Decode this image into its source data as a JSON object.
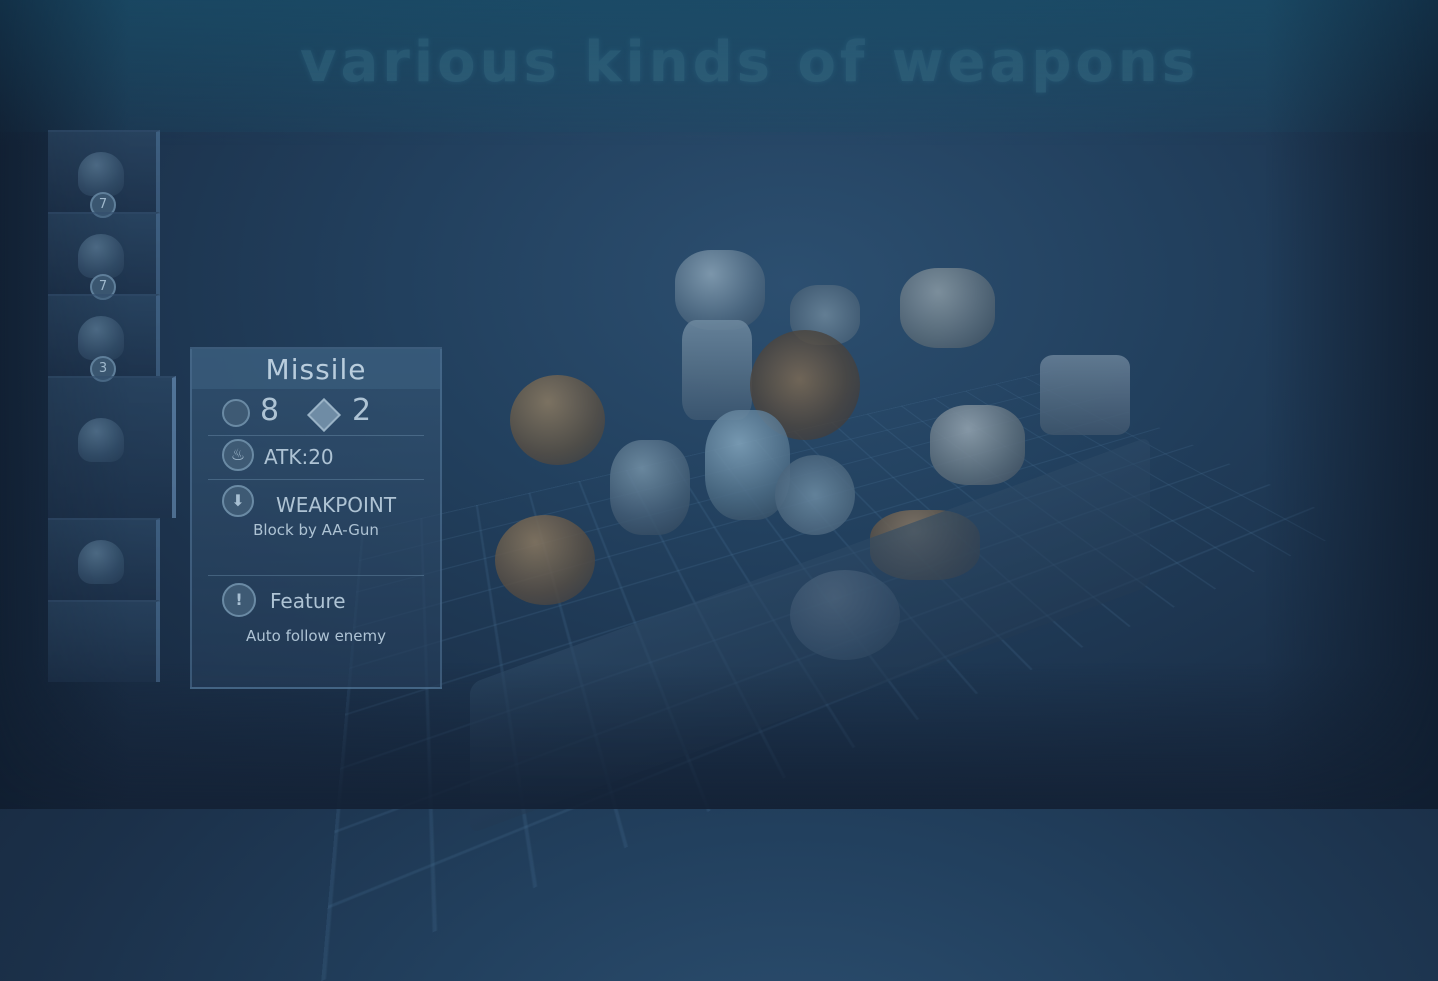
{
  "banner": {
    "title": "various kinds of weapons"
  },
  "inventory": {
    "slots": [
      {
        "count": "7"
      },
      {
        "count": "7"
      },
      {
        "count": "3"
      }
    ]
  },
  "info_panel": {
    "title": "Missile",
    "cost_coin": "8",
    "cost_gem": "2",
    "attack": "ATK:20",
    "weakpoint_label": "WEAKPOINT",
    "weakpoint_desc": "Block by AA-Gun",
    "feature_label": "Feature",
    "feature_desc": "Auto follow enemy"
  },
  "icons": [
    "coin-icon",
    "gem-icon",
    "attack-icon",
    "down-arrow-icon",
    "exclamation-icon"
  ],
  "colors": {
    "background": "#1f3a57",
    "panel": "#34547a",
    "text": "#aec3d4"
  }
}
